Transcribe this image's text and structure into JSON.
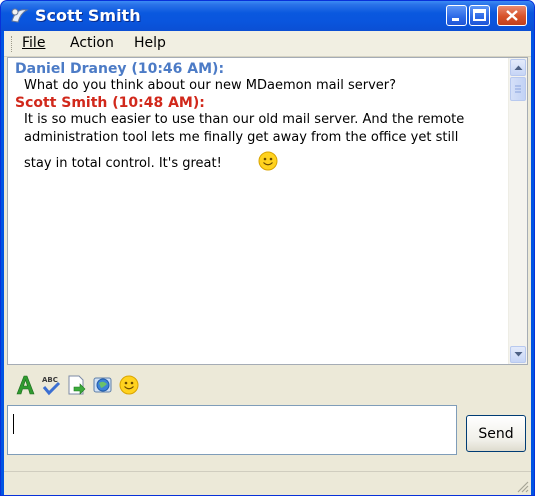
{
  "window": {
    "title": "Scott Smith"
  },
  "menu": {
    "file": "File",
    "action": "Action",
    "help": "Help"
  },
  "messages": [
    {
      "sender": "Daniel Draney (10:46 AM):",
      "lines": [
        "What do you think about our new MDaemon mail server?"
      ]
    },
    {
      "sender": "Scott Smith (10:48 AM):",
      "lines": [
        "It is so much easier to use than our old mail server. And the remote",
        "administration tool lets me finally get away from the office yet still",
        "stay in total control. It's great!"
      ]
    }
  ],
  "emoticon": "smiley-icon",
  "toolbar": {
    "icons": [
      "font-icon",
      "spellcheck-icon",
      "send-file-icon",
      "globe-icon",
      "emoticon-icon"
    ]
  },
  "input": {
    "value": ""
  },
  "send_label": "Send",
  "colors": {
    "titlebar": "#0a55dd",
    "sender_1": "#4c7bc6",
    "sender_2": "#d1281b",
    "chrome": "#ece9d8"
  }
}
